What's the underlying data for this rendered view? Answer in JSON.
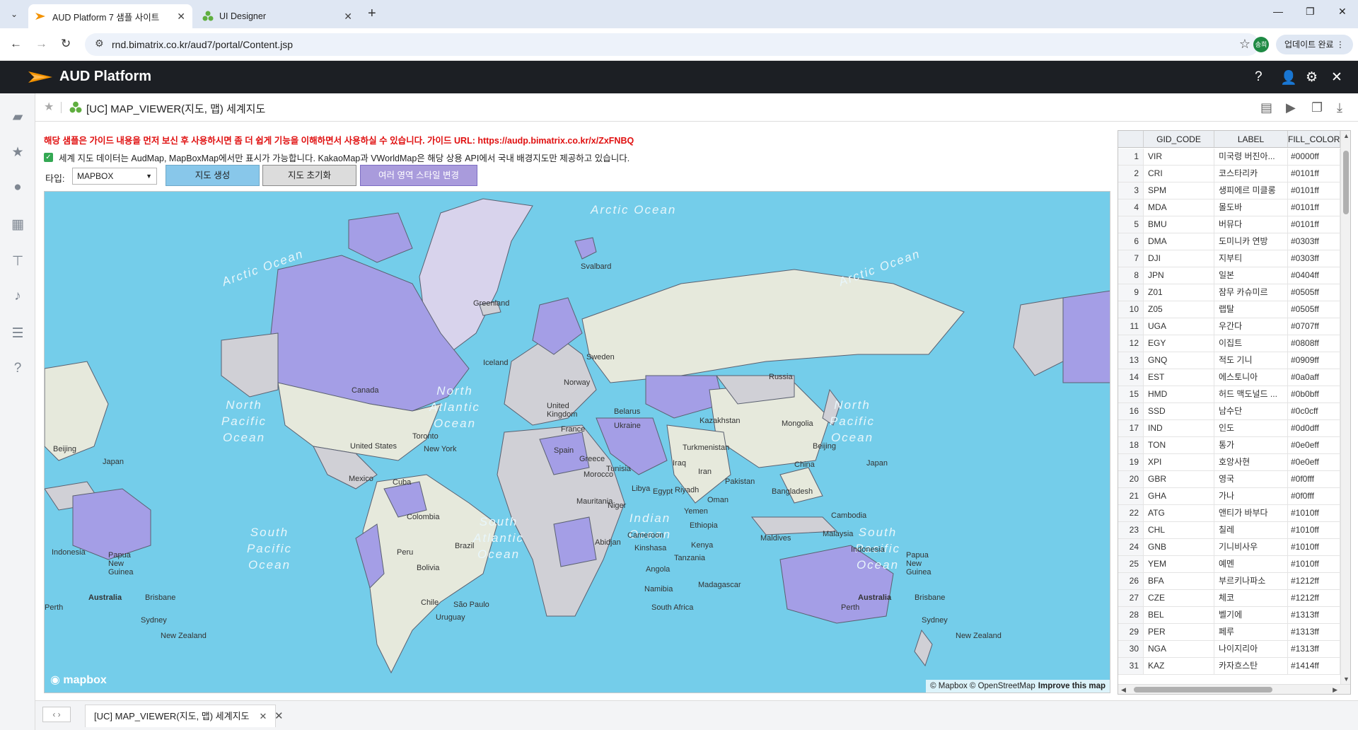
{
  "browser": {
    "tabs": [
      {
        "title": "AUD Platform 7 샘플 사이트",
        "active": true
      },
      {
        "title": "UI Designer",
        "active": false
      }
    ],
    "url": "rnd.bimatrix.co.kr/aud7/portal/Content.jsp",
    "profile_label": "송희",
    "update_label": "업데이트 완료"
  },
  "app": {
    "title": "AUD Platform",
    "header_icons": [
      "help-icon",
      "user-icon",
      "gear-icon",
      "close-icon"
    ]
  },
  "rail_icons": [
    "folder-icon",
    "star-icon",
    "user-icon",
    "dashboard-icon",
    "hierarchy-icon",
    "bell-icon",
    "list-icon",
    "help-icon"
  ],
  "content": {
    "page_title": "[UC] MAP_VIEWER(지도, 맵) 세계지도",
    "notice": "해당 샘플은 가이드 내용을 먼저 보신 후 사용하시면 좀 더 쉽게 기능을 이해하면서 사용하실 수 있습니다. 가이드 URL: https://audp.bimatrix.co.kr/x/ZxFNBQ",
    "info": "세계 지도 데이터는 AudMap, MapBoxMap에서만 표시가 가능합니다. KakaoMap과 VWorldMap은 해당 상용 API에서 국내 배경지도만 제공하고 있습니다.",
    "type_label": "타입:",
    "type_value": "MAPBOX",
    "buttons": {
      "create": "지도 생성",
      "reset": "지도 초기화",
      "style": "여러 영역 스타일 변경"
    }
  },
  "map": {
    "logo": "mapbox",
    "attribution": "© Mapbox © OpenStreetMap",
    "improve": "Improve this map",
    "colors": {
      "ocean": "#74cdea",
      "land": "#e6e9dc",
      "highlight": "#a49ee6",
      "gray": "#d0d0d6"
    },
    "oceans": [
      {
        "text": "Arctic Ocean"
      },
      {
        "text": "Arctic Ocean"
      },
      {
        "text": "Arctic Ocean"
      },
      {
        "text": "North Pacific Ocean"
      },
      {
        "text": "North Atlantic Ocean"
      },
      {
        "text": "North Pacific Ocean"
      },
      {
        "text": "South Pacific Ocean"
      },
      {
        "text": "South Atlantic Ocean"
      },
      {
        "text": "Indian Ocean"
      },
      {
        "text": "South Pacific Ocean"
      }
    ],
    "labels": [
      "Greenland",
      "Svalbard",
      "Iceland",
      "Canada",
      "United States",
      "New York",
      "Toronto",
      "Mexico",
      "Cuba",
      "Colombia",
      "Peru",
      "Brazil",
      "Bolivia",
      "Chile",
      "São Paulo",
      "Uruguay",
      "Sweden",
      "Norway",
      "United Kingdom",
      "France",
      "Spain",
      "Ukraine",
      "Belarus",
      "Russia",
      "Kazakhstan",
      "Mongolia",
      "Beijing",
      "Japan",
      "China",
      "Iran",
      "Iraq",
      "Turkmenistan",
      "Pakistan",
      "Bangladesh",
      "Riyadh",
      "Egypt",
      "Libya",
      "Oman",
      "Yemen",
      "Morocco",
      "Tunisia",
      "Mauritania",
      "Niger",
      "Cameroon",
      "Abidjan",
      "Kinshasa",
      "Ethiopia",
      "Kenya",
      "Tanzania",
      "Angola",
      "Namibia",
      "South Africa",
      "Madagascar",
      "Maldives",
      "Malaysia",
      "Cambodia",
      "Indonesia",
      "Papua New Guinea",
      "Australia",
      "Brisbane",
      "Perth",
      "Sydney",
      "New Zealand",
      "Greece",
      "Beijing",
      "Japan",
      "Indonesia",
      "Papua New Guinea",
      "Australia",
      "Brisbane",
      "Perth",
      "Sydney",
      "New Zealand"
    ]
  },
  "grid": {
    "columns": [
      "GID_CODE",
      "LABEL",
      "FILL_COLOR"
    ],
    "rows": [
      [
        "1",
        "VIR",
        "미국령 버진아...",
        "#0000ff"
      ],
      [
        "2",
        "CRI",
        "코스타리카",
        "#0101ff"
      ],
      [
        "3",
        "SPM",
        "생피에르 미클롱",
        "#0101ff"
      ],
      [
        "4",
        "MDA",
        "몰도바",
        "#0101ff"
      ],
      [
        "5",
        "BMU",
        "버뮤다",
        "#0101ff"
      ],
      [
        "6",
        "DMA",
        "도미니카 연방",
        "#0303ff"
      ],
      [
        "7",
        "DJI",
        "지부티",
        "#0303ff"
      ],
      [
        "8",
        "JPN",
        "일본",
        "#0404ff"
      ],
      [
        "9",
        "Z01",
        "잠무 카슈미르",
        "#0505ff"
      ],
      [
        "10",
        "Z05",
        "랩탈",
        "#0505ff"
      ],
      [
        "11",
        "UGA",
        "우간다",
        "#0707ff"
      ],
      [
        "12",
        "EGY",
        "이집트",
        "#0808ff"
      ],
      [
        "13",
        "GNQ",
        "적도 기니",
        "#0909ff"
      ],
      [
        "14",
        "EST",
        "에스토니아",
        "#0a0aff"
      ],
      [
        "15",
        "HMD",
        "허드 맥도널드 ...",
        "#0b0bff"
      ],
      [
        "16",
        "SSD",
        "남수단",
        "#0c0cff"
      ],
      [
        "17",
        "IND",
        "인도",
        "#0d0dff"
      ],
      [
        "18",
        "TON",
        "통가",
        "#0e0eff"
      ],
      [
        "19",
        "XPI",
        "호앙사현",
        "#0e0eff"
      ],
      [
        "20",
        "GBR",
        "영국",
        "#0f0fff"
      ],
      [
        "21",
        "GHA",
        "가나",
        "#0f0fff"
      ],
      [
        "22",
        "ATG",
        "앤티가 바부다",
        "#1010ff"
      ],
      [
        "23",
        "CHL",
        "칠레",
        "#1010ff"
      ],
      [
        "24",
        "GNB",
        "기니비사우",
        "#1010ff"
      ],
      [
        "25",
        "YEM",
        "예멘",
        "#1010ff"
      ],
      [
        "26",
        "BFA",
        "부르키나파소",
        "#1212ff"
      ],
      [
        "27",
        "CZE",
        "체코",
        "#1212ff"
      ],
      [
        "28",
        "BEL",
        "벨기에",
        "#1313ff"
      ],
      [
        "29",
        "PER",
        "페루",
        "#1313ff"
      ],
      [
        "30",
        "NGA",
        "나이지리아",
        "#1313ff"
      ],
      [
        "31",
        "KAZ",
        "카자흐스탄",
        "#1414ff"
      ]
    ]
  },
  "bottom": {
    "tab_title": "[UC] MAP_VIEWER(지도, 맵) 세계지도"
  }
}
